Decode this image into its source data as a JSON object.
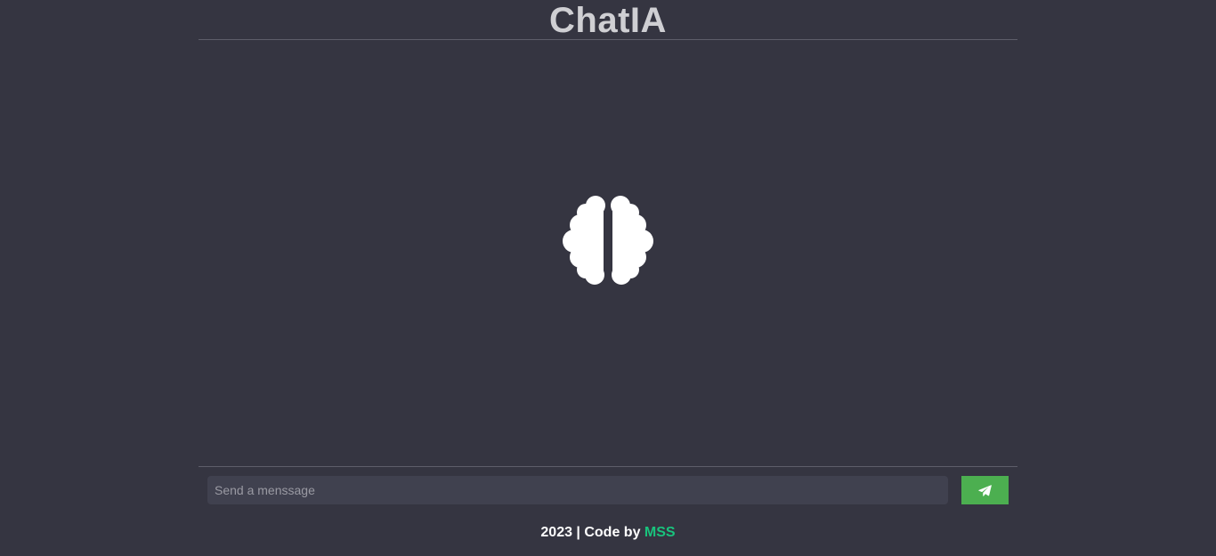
{
  "header": {
    "title": "ChatIA"
  },
  "chat": {
    "center_icon": "brain-icon"
  },
  "composer": {
    "placeholder": "Send a menssage",
    "value": "",
    "send_icon": "paper-plane-icon"
  },
  "footer": {
    "text": "2023 | Code by",
    "author": "MSS"
  },
  "colors": {
    "background": "#353541",
    "input_background": "#40414f",
    "send_button": "#4caf50",
    "author_link": "#19c37d",
    "title": "#cfcfd3"
  }
}
